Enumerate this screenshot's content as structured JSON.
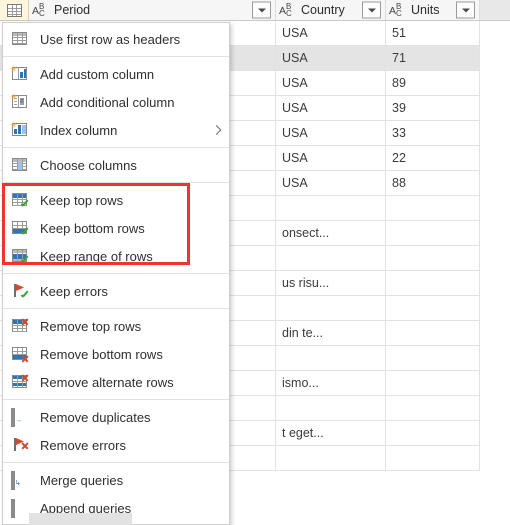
{
  "grid": {
    "corner_icon": "table-icon",
    "columns": [
      {
        "name": "Period",
        "type_icon": "abc-type-icon",
        "filter_icon": "filter-dropdown-icon"
      },
      {
        "name": "Country",
        "type_icon": "abc-type-icon",
        "filter_icon": "filter-dropdown-icon"
      },
      {
        "name": "Units",
        "type_icon": "abc-type-icon",
        "filter_icon": "filter-dropdown-icon"
      }
    ],
    "rows": [
      {
        "period": "",
        "country": "USA",
        "units": "51",
        "selected": false
      },
      {
        "period": "",
        "country": "USA",
        "units": "71",
        "selected": true
      },
      {
        "period": "",
        "country": "USA",
        "units": "89",
        "selected": false
      },
      {
        "period": "",
        "country": "USA",
        "units": "39",
        "selected": false
      },
      {
        "period": "",
        "country": "USA",
        "units": "33",
        "selected": false
      },
      {
        "period": "",
        "country": "USA",
        "units": "22",
        "selected": false
      },
      {
        "period": "",
        "country": "USA",
        "units": "88",
        "selected": false
      },
      {
        "period": "",
        "country": "",
        "units": "",
        "selected": false
      },
      {
        "period": "",
        "country": "onsect...",
        "units": "",
        "selected": false
      },
      {
        "period": "",
        "country": "",
        "units": "",
        "selected": false
      },
      {
        "period": "",
        "country": "us risu...",
        "units": "",
        "selected": false
      },
      {
        "period": "",
        "country": "",
        "units": "",
        "selected": false
      },
      {
        "period": "",
        "country": "din te...",
        "units": "",
        "selected": false
      },
      {
        "period": "",
        "country": "",
        "units": "",
        "selected": false
      },
      {
        "period": "",
        "country": "ismo...",
        "units": "",
        "selected": false
      },
      {
        "period": "",
        "country": "",
        "units": "",
        "selected": false
      },
      {
        "period": "",
        "country": "t eget...",
        "units": "",
        "selected": false
      },
      {
        "period": "",
        "country": "",
        "units": "",
        "selected": false
      }
    ]
  },
  "menu": {
    "groups": [
      {
        "items": [
          {
            "label": "Use first row as headers",
            "icon": "use-first-row-as-headers-icon",
            "submenu": false
          }
        ]
      },
      {
        "items": [
          {
            "label": "Add custom column",
            "icon": "add-custom-column-icon",
            "submenu": false
          },
          {
            "label": "Add conditional column",
            "icon": "add-conditional-column-icon",
            "submenu": false
          },
          {
            "label": "Index column",
            "icon": "index-column-icon",
            "submenu": true
          }
        ]
      },
      {
        "items": [
          {
            "label": "Choose columns",
            "icon": "choose-columns-icon",
            "submenu": false
          }
        ]
      },
      {
        "items": [
          {
            "label": "Keep top rows",
            "icon": "keep-top-rows-icon",
            "submenu": false
          },
          {
            "label": "Keep bottom rows",
            "icon": "keep-bottom-rows-icon",
            "submenu": false
          },
          {
            "label": "Keep range of rows",
            "icon": "keep-range-of-rows-icon",
            "submenu": false
          }
        ]
      },
      {
        "items": [
          {
            "label": "Keep errors",
            "icon": "keep-errors-icon",
            "submenu": false
          }
        ]
      },
      {
        "items": [
          {
            "label": "Remove top rows",
            "icon": "remove-top-rows-icon",
            "submenu": false
          },
          {
            "label": "Remove bottom rows",
            "icon": "remove-bottom-rows-icon",
            "submenu": false
          },
          {
            "label": "Remove alternate rows",
            "icon": "remove-alternate-rows-icon",
            "submenu": false
          }
        ]
      },
      {
        "items": [
          {
            "label": "Remove duplicates",
            "icon": "remove-duplicates-icon",
            "submenu": false
          },
          {
            "label": "Remove errors",
            "icon": "remove-errors-icon",
            "submenu": false
          }
        ]
      },
      {
        "items": [
          {
            "label": "Merge queries",
            "icon": "merge-queries-icon",
            "submenu": false
          },
          {
            "label": "Append queries",
            "icon": "append-queries-icon",
            "submenu": false
          }
        ]
      }
    ]
  },
  "highlight": {
    "color": "#f1322f",
    "target_labels": [
      "Keep top rows",
      "Keep bottom rows",
      "Keep range of rows"
    ]
  }
}
